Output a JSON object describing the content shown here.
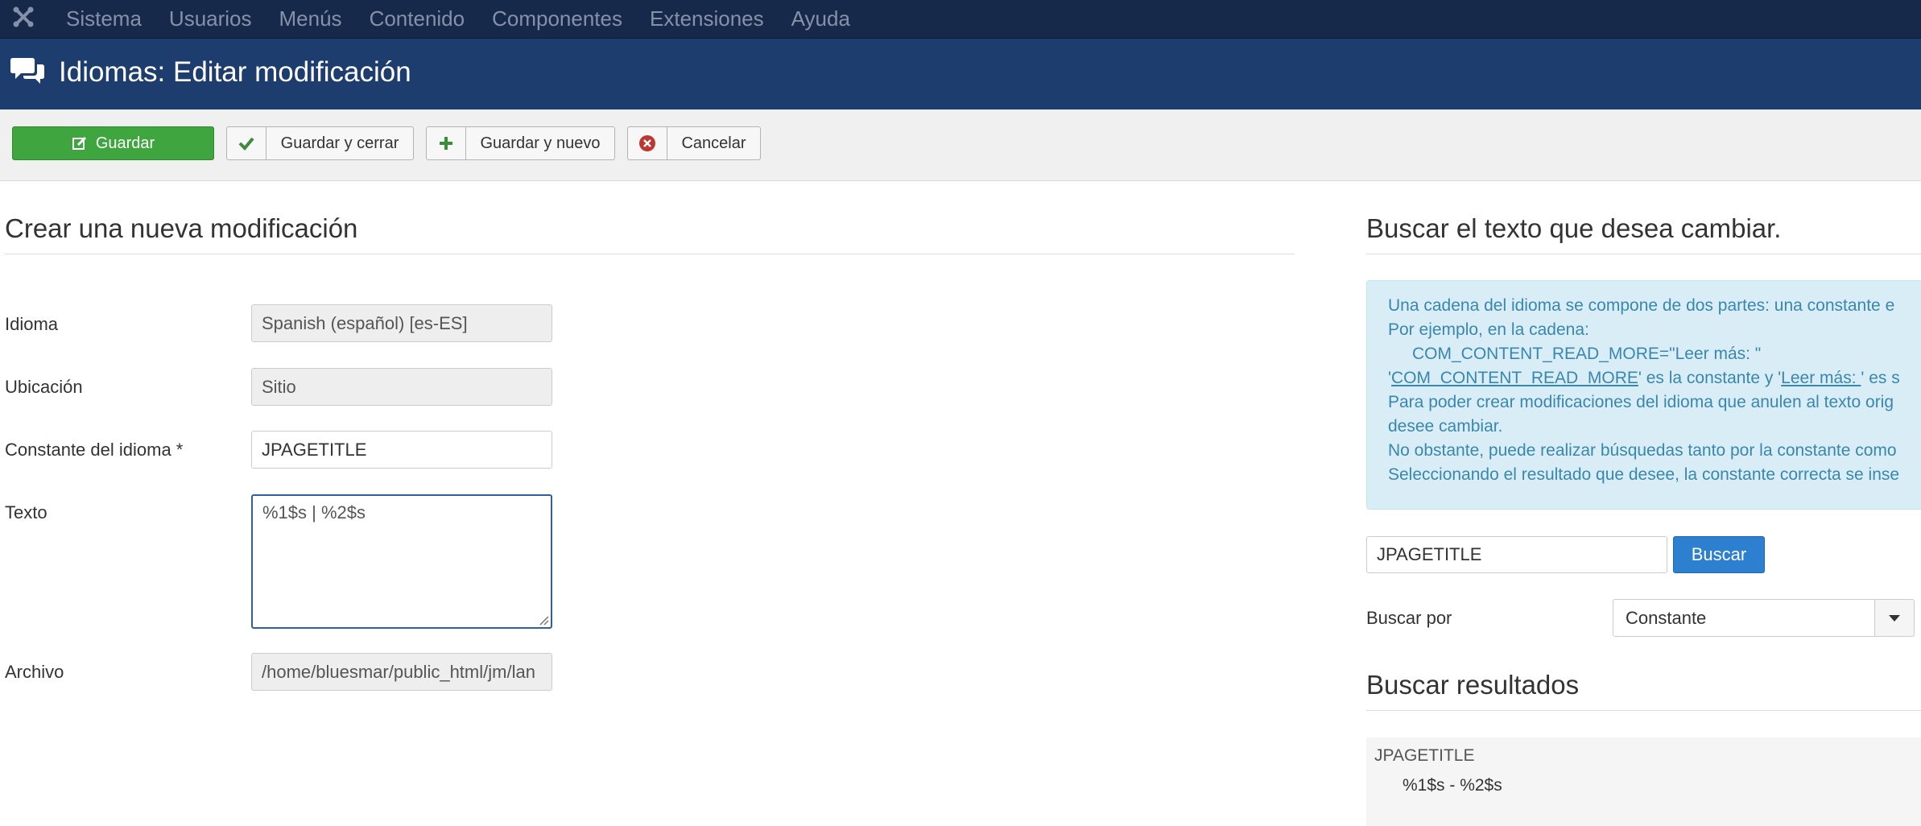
{
  "topnav": {
    "items": [
      "Sistema",
      "Usuarios",
      "Menús",
      "Contenido",
      "Componentes",
      "Extensiones",
      "Ayuda"
    ]
  },
  "header": {
    "title": "Idiomas: Editar modificación"
  },
  "toolbar": {
    "save": "Guardar",
    "save_close": "Guardar y cerrar",
    "save_new": "Guardar y nuevo",
    "cancel": "Cancelar"
  },
  "form": {
    "heading": "Crear una nueva modificación",
    "language_label": "Idioma",
    "language_value": "Spanish (español) [es-ES]",
    "location_label": "Ubicación",
    "location_value": "Sitio",
    "constant_label": "Constante del idioma *",
    "constant_value": "JPAGETITLE",
    "text_label": "Texto",
    "text_value": "%1$s | %2$s",
    "file_label": "Archivo",
    "file_value": "/home/bluesmar/public_html/jm/lan"
  },
  "search": {
    "heading": "Buscar el texto que desea cambiar.",
    "info": {
      "line1": "Una cadena del idioma se compone de dos partes: una constante e",
      "line2": "Por ejemplo, en la cadena:",
      "line3": "COM_CONTENT_READ_MORE=\"Leer más: \"",
      "line4_a": "'",
      "line4_const": "COM_CONTENT_READ_MORE",
      "line4_b": "' es la constante y '",
      "line4_text": "Leer más: ",
      "line4_c": "' es s",
      "line5": "Para poder crear modificaciones del idioma que anulen al texto orig",
      "line6": "desee cambiar.",
      "line7": "No obstante, puede realizar búsquedas tanto por la constante como",
      "line8": "Seleccionando el resultado que desee, la constante correcta se inse"
    },
    "input_value": "JPAGETITLE",
    "button": "Buscar",
    "by_label": "Buscar por",
    "by_value": "Constante"
  },
  "results": {
    "heading": "Buscar resultados",
    "constant": "JPAGETITLE",
    "text": "%1$s - %2$s"
  },
  "colors": {
    "topbar": "#17294a",
    "titlebar": "#1c3d6e",
    "save_green": "#3fa53f",
    "search_blue": "#2d7fcf",
    "info_bg": "#d9edf7"
  }
}
